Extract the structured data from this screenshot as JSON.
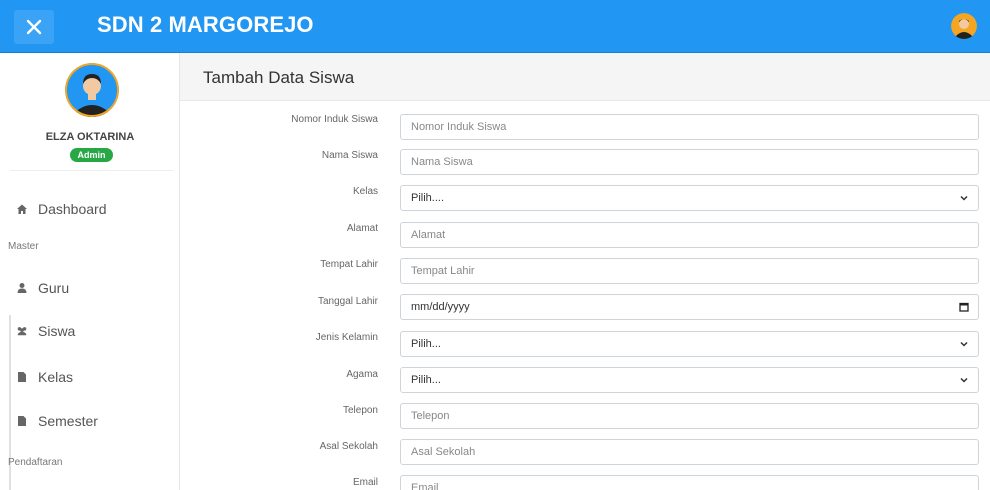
{
  "app": {
    "title": "SDN 2 MARGOREJO"
  },
  "profile": {
    "name": "ELZA OKTARINA",
    "role": "Admin"
  },
  "sidebar": {
    "dashboard": "Dashboard",
    "section_master": "Master",
    "items": [
      {
        "label": "Guru",
        "icon": "user-icon"
      },
      {
        "label": "Siswa",
        "icon": "users-icon"
      },
      {
        "label": "Kelas",
        "icon": "file-icon"
      },
      {
        "label": "Semester",
        "icon": "file-icon"
      }
    ],
    "section_pendaftaran": "Pendaftaran"
  },
  "page": {
    "title": "Tambah Data Siswa"
  },
  "form": {
    "nis": {
      "label": "Nomor Induk Siswa",
      "placeholder": "Nomor Induk Siswa"
    },
    "nama": {
      "label": "Nama Siswa",
      "placeholder": "Nama Siswa"
    },
    "kelas": {
      "label": "Kelas",
      "value": "Pilih...."
    },
    "alamat": {
      "label": "Alamat",
      "placeholder": "Alamat"
    },
    "tempat_lahir": {
      "label": "Tempat Lahir",
      "placeholder": "Tempat Lahir"
    },
    "tanggal_lahir": {
      "label": "Tanggal Lahir",
      "value": "mm/dd/yyyy"
    },
    "jenis_kelamin": {
      "label": "Jenis Kelamin",
      "value": "Pilih..."
    },
    "agama": {
      "label": "Agama",
      "value": "Pilih..."
    },
    "telepon": {
      "label": "Telepon",
      "placeholder": "Telepon"
    },
    "asal_sekolah": {
      "label": "Asal Sekolah",
      "placeholder": "Asal Sekolah"
    },
    "email": {
      "label": "Email",
      "placeholder": "Email"
    }
  },
  "colors": {
    "topbar": "#2196f3",
    "badge": "#28a745",
    "avatar_bg": "#2196f3",
    "avatar_accent": "#f4a623"
  }
}
